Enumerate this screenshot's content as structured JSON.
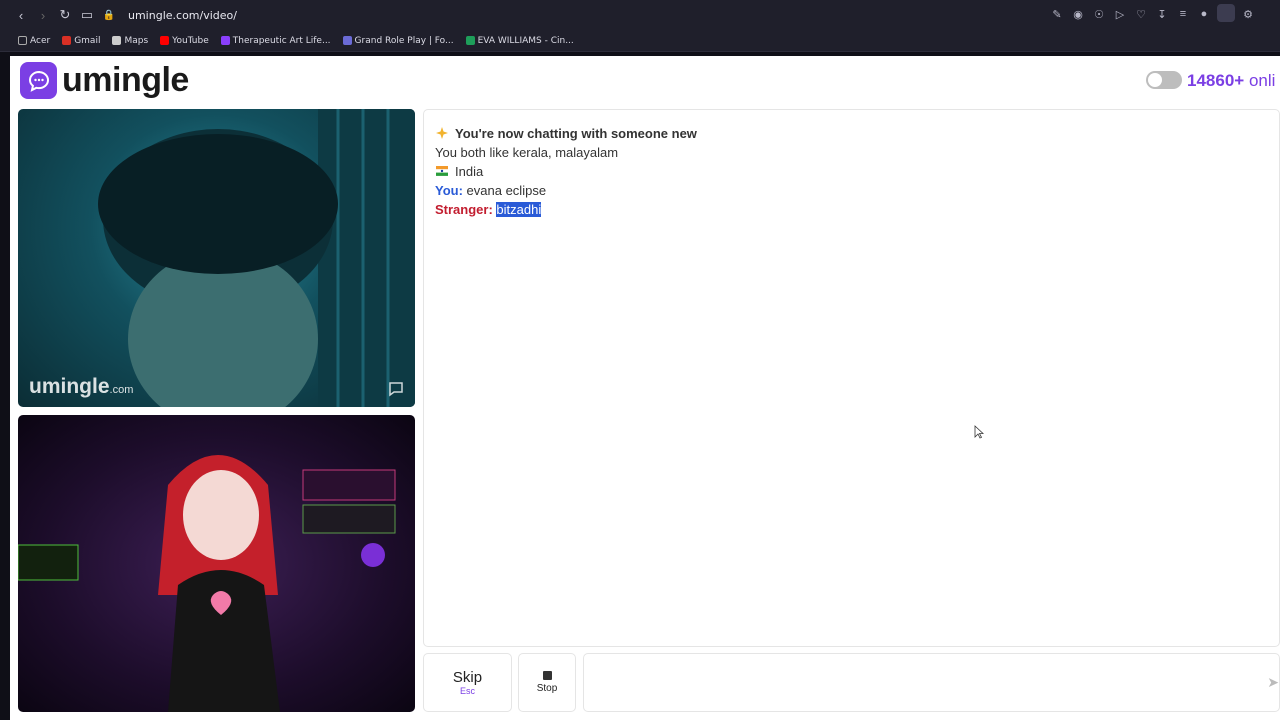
{
  "browser": {
    "url": "umingle.com/video/",
    "bookmarks": [
      {
        "label": "Acer",
        "color": "#888888"
      },
      {
        "label": "Gmail",
        "color": "#d93025"
      },
      {
        "label": "Maps",
        "color": "#cccccc"
      },
      {
        "label": "YouTube",
        "color": "#ff0000"
      },
      {
        "label": "Therapeutic Art Life...",
        "color": "#8a3ffc"
      },
      {
        "label": "Grand Role Play | Fo...",
        "color": "#6b6bd6"
      },
      {
        "label": "EVA WILLIAMS - Cin...",
        "color": "#1e9e5a"
      }
    ]
  },
  "header": {
    "logo_text": "umingle",
    "online_count": "14860+",
    "online_suffix": "onli",
    "accent_color": "#7b3fe4"
  },
  "videos": {
    "top_watermark": "umingle",
    "top_watermark_suffix": ".com"
  },
  "chat": {
    "intro": "You're now chatting with someone new",
    "interests": "You both like kerala, malayalam",
    "country": "India",
    "you_label": "You:",
    "you_name": "evana eclipse",
    "stranger_label": "Stranger:",
    "stranger_name": "bitzadhi"
  },
  "controls": {
    "skip_label": "Skip",
    "skip_key": "Esc",
    "stop_label": "Stop",
    "input_placeholder": ""
  }
}
